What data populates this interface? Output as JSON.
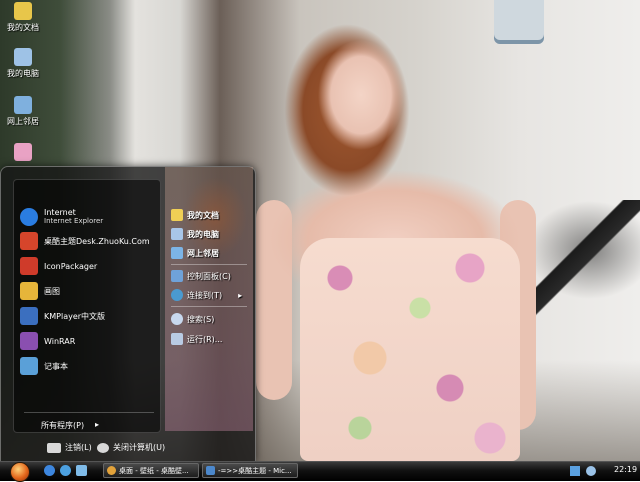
{
  "desktop": {
    "icons": [
      {
        "label": "我的文档",
        "icon": "folder-documents-icon",
        "color": "#e8c64a"
      },
      {
        "label": "我的电脑",
        "icon": "computer-icon",
        "color": "#9ec2e6"
      },
      {
        "label": "网上邻居",
        "icon": "network-icon",
        "color": "#7fb0de"
      },
      {
        "label": "",
        "icon": "recycle-bin-icon",
        "color": "#e9a2c4"
      }
    ]
  },
  "start_menu": {
    "programs": [
      {
        "label": "Internet",
        "sub": "Internet Explorer",
        "icon": "ie-icon",
        "color": "#2a7de1"
      },
      {
        "label": "桌酷主题Desk.ZhuoKu.Com",
        "sub": "",
        "icon": "zhuoku-icon",
        "color": "#d6452b"
      },
      {
        "label": "IconPackager",
        "sub": "",
        "icon": "iconpackager-icon",
        "color": "#cf3b2a"
      },
      {
        "label": "画图",
        "sub": "",
        "icon": "paint-icon",
        "color": "#e6b53a"
      },
      {
        "label": "KMPlayer中文版",
        "sub": "",
        "icon": "kmplayer-icon",
        "color": "#3b6fbf"
      },
      {
        "label": "WinRAR",
        "sub": "",
        "icon": "winrar-icon",
        "color": "#8a4fb0"
      },
      {
        "label": "记事本",
        "sub": "",
        "icon": "notepad-icon",
        "color": "#5aa0d8"
      }
    ],
    "all_programs": "所有程序(P)",
    "all_programs_arrow": "▸",
    "places": [
      {
        "label": "我的文档",
        "icon": "documents-icon",
        "color": "#f0cf55",
        "bold": true
      },
      {
        "label": "我的电脑",
        "icon": "computer-icon",
        "color": "#a8c6e8",
        "bold": true
      },
      {
        "label": "网上邻居",
        "icon": "network-icon",
        "color": "#7cb4e6",
        "bold": true
      },
      {
        "label": "控制面板(C)",
        "icon": "control-panel-icon",
        "color": "#6fa2d9",
        "bold": false
      },
      {
        "label": "连接到(T)",
        "icon": "connect-icon",
        "color": "#4a9ad0",
        "bold": false,
        "arrow": "▸"
      },
      {
        "label": "搜索(S)",
        "icon": "search-icon",
        "color": "#c8d8ee",
        "bold": false
      },
      {
        "label": "运行(R)...",
        "icon": "run-icon",
        "color": "#b9cbe4",
        "bold": false
      }
    ],
    "logoff": "注销(L)",
    "shutdown": "关闭计算机(U)"
  },
  "taskbar": {
    "tasks": [
      {
        "label": "桌面 - 壁纸 - 桌酷壁...",
        "icon": "browser-icon",
        "color": "#e2a23a"
      },
      {
        "label": "-=>>桌酷主题 - Mic...",
        "icon": "window-icon",
        "color": "#4c88cc"
      }
    ],
    "quick_launch": [
      {
        "icon": "ie-quicklaunch-icon",
        "color": "#3d86de"
      },
      {
        "icon": "media-quicklaunch-icon",
        "color": "#4ca0e0"
      },
      {
        "icon": "desktop-quicklaunch-icon",
        "color": "#7fbbe8"
      }
    ],
    "clock": "22:19"
  }
}
